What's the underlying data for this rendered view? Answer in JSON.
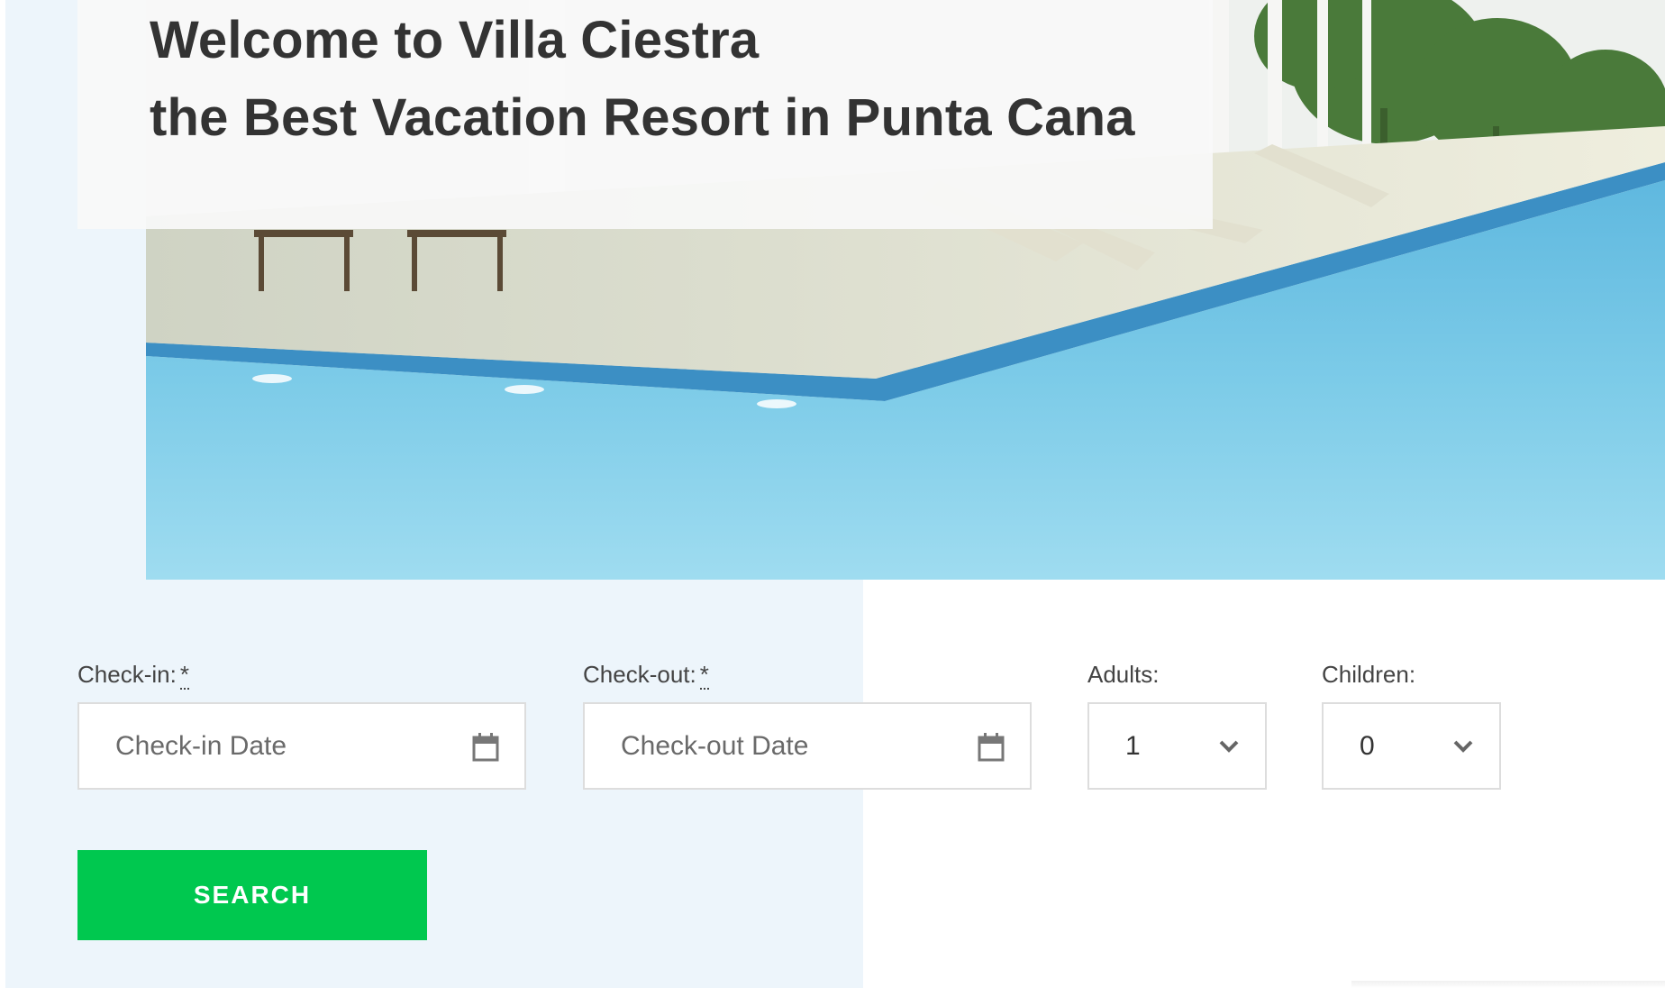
{
  "hero": {
    "title_line1": "Welcome to Villa Ciestra",
    "title_line2": "the Best Vacation Resort in Punta Cana",
    "image": "resort-pool-image"
  },
  "booking": {
    "checkin_label": "Check-in:",
    "checkout_label": "Check-out:",
    "required_mark": "*",
    "checkin_placeholder": "Check-in Date",
    "checkout_placeholder": "Check-out Date",
    "adults_label": "Adults:",
    "adults_value": "1",
    "children_label": "Children:",
    "children_value": "0",
    "search_label": "SEARCH",
    "calendar_icon": "calendar-icon",
    "chevron_icon": "chevron-down-icon"
  },
  "colors": {
    "accent": "#00c84f",
    "panel_bg": "#edf5fb",
    "title_text": "#333333"
  }
}
